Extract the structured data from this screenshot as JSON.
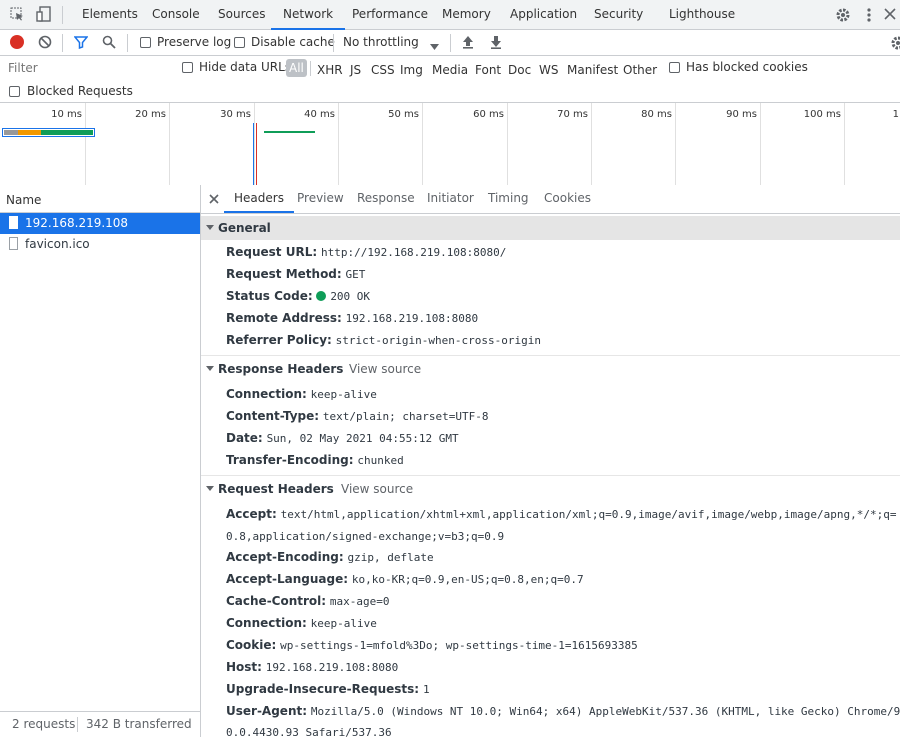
{
  "tabs": [
    "Elements",
    "Console",
    "Sources",
    "Network",
    "Performance",
    "Memory",
    "Application",
    "Security",
    "Lighthouse"
  ],
  "toolbar": {
    "preserve_log": "Preserve log",
    "disable_cache": "Disable cache",
    "throttling": "No throttling"
  },
  "filter": {
    "placeholder": "Filter",
    "hide_data_urls": "Hide data URLs",
    "all": "All",
    "types": [
      "XHR",
      "JS",
      "CSS",
      "Img",
      "Media",
      "Font",
      "Doc",
      "WS",
      "Manifest",
      "Other"
    ],
    "has_blocked_cookies": "Has blocked cookies",
    "blocked_requests": "Blocked Requests"
  },
  "timeline": {
    "ticks": [
      "10 ms",
      "20 ms",
      "30 ms",
      "40 ms",
      "50 ms",
      "60 ms",
      "70 ms",
      "80 ms",
      "90 ms",
      "100 ms",
      "1"
    ]
  },
  "requests": {
    "header": "Name",
    "items": [
      "192.168.219.108",
      "favicon.ico"
    ],
    "footer_count": "2 requests",
    "footer_transferred": "342 B transferred"
  },
  "detail_tabs": [
    "Headers",
    "Preview",
    "Response",
    "Initiator",
    "Timing",
    "Cookies"
  ],
  "general": {
    "title": "General",
    "rows": [
      {
        "k": "Request URL:",
        "v": "http://192.168.219.108:8080/"
      },
      {
        "k": "Request Method:",
        "v": "GET"
      },
      {
        "k": "Status Code:",
        "v": "200 OK"
      },
      {
        "k": "Remote Address:",
        "v": "192.168.219.108:8080"
      },
      {
        "k": "Referrer Policy:",
        "v": "strict-origin-when-cross-origin"
      }
    ]
  },
  "response_headers": {
    "title": "Response Headers",
    "view_source": "View source",
    "rows": [
      {
        "k": "Connection:",
        "v": "keep-alive"
      },
      {
        "k": "Content-Type:",
        "v": "text/plain; charset=UTF-8"
      },
      {
        "k": "Date:",
        "v": "Sun, 02 May 2021 04:55:12 GMT"
      },
      {
        "k": "Transfer-Encoding:",
        "v": "chunked"
      }
    ]
  },
  "request_headers": {
    "title": "Request Headers",
    "view_source": "View source",
    "accept_k": "Accept:",
    "accept_v1": "text/html,application/xhtml+xml,application/xml;q=0.9,image/avif,image/webp,image/apng,*/*;q=",
    "accept_v2": "0.8,application/signed-exchange;v=b3;q=0.9",
    "rows": [
      {
        "k": "Accept-Encoding:",
        "v": "gzip, deflate"
      },
      {
        "k": "Accept-Language:",
        "v": "ko,ko-KR;q=0.9,en-US;q=0.8,en;q=0.7"
      },
      {
        "k": "Cache-Control:",
        "v": "max-age=0"
      },
      {
        "k": "Connection:",
        "v": "keep-alive"
      },
      {
        "k": "Cookie:",
        "v": "wp-settings-1=mfold%3Do; wp-settings-time-1=1615693385"
      },
      {
        "k": "Host:",
        "v": "192.168.219.108:8080"
      },
      {
        "k": "Upgrade-Insecure-Requests:",
        "v": "1"
      }
    ],
    "ua_k": "User-Agent:",
    "ua_v1": "Mozilla/5.0 (Windows NT 10.0; Win64; x64) AppleWebKit/537.36 (KHTML, like Gecko) Chrome/9",
    "ua_v2": "0.0.4430.93 Safari/537.36"
  },
  "colors": {
    "accent": "#1a73e8",
    "record": "#d93025",
    "status_ok": "#0f9d58",
    "selected": "#1a73e8"
  }
}
